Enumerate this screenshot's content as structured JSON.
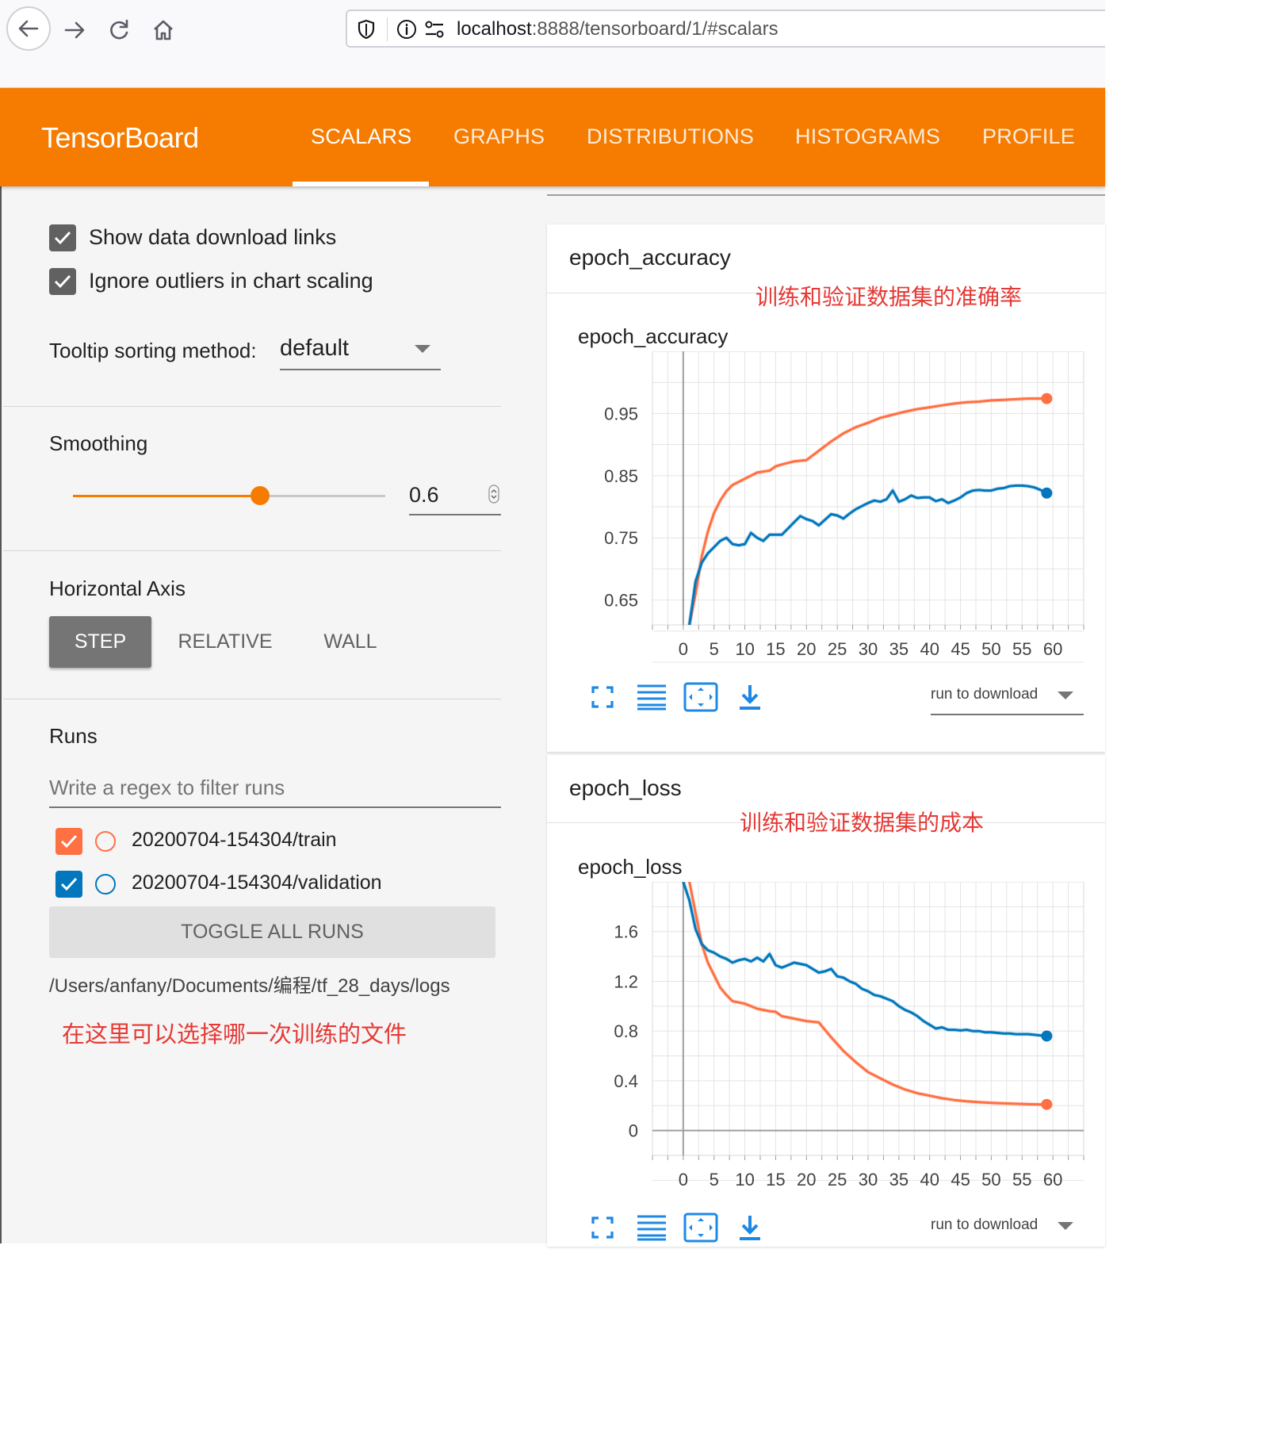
{
  "browser": {
    "url_host": "localhost",
    "url_rest": ":8888/tensorboard/1/#scalars"
  },
  "header": {
    "brand": "TensorBoard",
    "tabs": [
      "SCALARS",
      "GRAPHS",
      "DISTRIBUTIONS",
      "HISTOGRAMS",
      "PROFILE"
    ],
    "active_tab": "SCALARS",
    "color": "#f57c00"
  },
  "sidebar": {
    "options": [
      {
        "label": "Show data download links",
        "checked": true
      },
      {
        "label": "Ignore outliers in chart scaling",
        "checked": true
      }
    ],
    "tooltip_label": "Tooltip sorting method:",
    "tooltip_value": "default",
    "smoothing_title": "Smoothing",
    "smoothing_value": "0.6",
    "horizontal_axis_title": "Horizontal Axis",
    "axis_buttons": [
      "STEP",
      "RELATIVE",
      "WALL"
    ],
    "axis_selected": "STEP",
    "runs_title": "Runs",
    "filter_placeholder": "Write a regex to filter runs",
    "runs": [
      {
        "name": "20200704-154304/train",
        "checked": true,
        "color": "#ff7043"
      },
      {
        "name": "20200704-154304/validation",
        "checked": true,
        "color": "#0277bd"
      }
    ],
    "toggle_label": "TOGGLE ALL RUNS",
    "logdir": "/Users/anfany/Documents/编程/tf_28_days/logs",
    "note": "在这里可以选择哪一次训练的文件"
  },
  "cards": [
    {
      "title": "epoch_accuracy",
      "note": "训练和验证数据集的准确率",
      "chart_title": "epoch_accuracy",
      "download_label": "run to download"
    },
    {
      "title": "epoch_loss",
      "note": "训练和验证数据集的成本",
      "chart_title": "epoch_loss",
      "download_label": "run to download"
    }
  ],
  "chart_data": [
    {
      "type": "line",
      "title": "epoch_accuracy",
      "x_ticks": [
        0,
        5,
        10,
        15,
        20,
        25,
        30,
        35,
        40,
        45,
        50,
        55,
        60
      ],
      "y_ticks": [
        "0.65",
        "0.75",
        "0.85",
        "0.95"
      ],
      "xlim": [
        -5,
        65
      ],
      "ylim": [
        0.61,
        1.05
      ],
      "grid": true,
      "series": [
        {
          "name": "20200704-154304/train",
          "color": "#ff7043",
          "x": [
            1,
            2,
            3,
            4,
            5,
            6,
            7,
            8,
            10,
            12,
            14,
            15,
            16,
            18,
            20,
            22,
            24,
            26,
            28,
            30,
            32,
            34,
            36,
            38,
            40,
            42,
            44,
            46,
            48,
            50,
            52,
            54,
            56,
            58,
            59
          ],
          "y": [
            0.61,
            0.66,
            0.72,
            0.76,
            0.79,
            0.81,
            0.825,
            0.835,
            0.845,
            0.855,
            0.858,
            0.865,
            0.868,
            0.873,
            0.875,
            0.89,
            0.905,
            0.918,
            0.928,
            0.935,
            0.943,
            0.948,
            0.953,
            0.957,
            0.96,
            0.963,
            0.966,
            0.968,
            0.969,
            0.971,
            0.972,
            0.973,
            0.974,
            0.974,
            0.974
          ]
        },
        {
          "name": "20200704-154304/validation",
          "color": "#0277bd",
          "x": [
            1,
            2,
            3,
            4,
            5,
            6,
            7,
            8,
            9,
            10,
            11,
            12,
            13,
            14,
            15,
            16,
            17,
            18,
            19,
            20,
            21,
            22,
            23,
            24,
            25,
            26,
            27,
            28,
            29,
            30,
            31,
            32,
            33,
            34,
            35,
            36,
            37,
            38,
            39,
            40,
            41,
            42,
            43,
            44,
            45,
            46,
            47,
            48,
            49,
            50,
            51,
            52,
            53,
            54,
            55,
            56,
            57,
            58,
            59
          ],
          "y": [
            0.61,
            0.68,
            0.71,
            0.725,
            0.735,
            0.745,
            0.75,
            0.74,
            0.738,
            0.74,
            0.758,
            0.75,
            0.745,
            0.755,
            0.755,
            0.755,
            0.765,
            0.775,
            0.785,
            0.78,
            0.777,
            0.77,
            0.779,
            0.788,
            0.786,
            0.781,
            0.789,
            0.796,
            0.801,
            0.806,
            0.81,
            0.808,
            0.812,
            0.826,
            0.808,
            0.812,
            0.818,
            0.814,
            0.815,
            0.815,
            0.809,
            0.812,
            0.806,
            0.81,
            0.815,
            0.822,
            0.826,
            0.827,
            0.826,
            0.826,
            0.829,
            0.83,
            0.833,
            0.834,
            0.834,
            0.833,
            0.831,
            0.827,
            0.822
          ]
        }
      ]
    },
    {
      "type": "line",
      "title": "epoch_loss",
      "x_ticks": [
        0,
        5,
        10,
        15,
        20,
        25,
        30,
        35,
        40,
        45,
        50,
        55,
        60
      ],
      "y_ticks": [
        "0",
        "0.4",
        "0.8",
        "1.2",
        "1.6"
      ],
      "xlim": [
        -5,
        65
      ],
      "ylim": [
        -0.2,
        2.0
      ],
      "grid": true,
      "series": [
        {
          "name": "20200704-154304/train",
          "color": "#ff7043",
          "x": [
            1,
            2,
            3,
            4,
            5,
            6,
            7,
            8,
            10,
            12,
            14,
            15,
            16,
            18,
            20,
            22,
            24,
            26,
            28,
            30,
            32,
            34,
            36,
            38,
            40,
            42,
            44,
            46,
            48,
            50,
            52,
            54,
            56,
            58,
            59
          ],
          "y": [
            2.0,
            1.75,
            1.5,
            1.35,
            1.25,
            1.15,
            1.09,
            1.04,
            1.02,
            0.98,
            0.96,
            0.955,
            0.92,
            0.9,
            0.88,
            0.87,
            0.75,
            0.64,
            0.55,
            0.47,
            0.42,
            0.37,
            0.33,
            0.3,
            0.28,
            0.26,
            0.245,
            0.235,
            0.228,
            0.222,
            0.218,
            0.215,
            0.212,
            0.21,
            0.21
          ]
        },
        {
          "name": "20200704-154304/validation",
          "color": "#0277bd",
          "x": [
            0,
            1,
            2,
            3,
            4,
            5,
            6,
            7,
            8,
            9,
            10,
            11,
            12,
            13,
            14,
            15,
            16,
            17,
            18,
            19,
            20,
            21,
            22,
            23,
            24,
            25,
            26,
            27,
            28,
            29,
            30,
            31,
            32,
            33,
            34,
            35,
            36,
            37,
            38,
            39,
            40,
            41,
            42,
            43,
            44,
            45,
            46,
            47,
            48,
            49,
            50,
            51,
            52,
            53,
            54,
            55,
            56,
            57,
            58,
            59
          ],
          "y": [
            2.0,
            1.85,
            1.62,
            1.5,
            1.45,
            1.43,
            1.4,
            1.38,
            1.35,
            1.37,
            1.38,
            1.36,
            1.39,
            1.36,
            1.42,
            1.33,
            1.31,
            1.33,
            1.35,
            1.34,
            1.33,
            1.3,
            1.27,
            1.28,
            1.3,
            1.24,
            1.23,
            1.2,
            1.18,
            1.14,
            1.12,
            1.09,
            1.08,
            1.06,
            1.04,
            1.0,
            0.97,
            0.95,
            0.92,
            0.88,
            0.85,
            0.82,
            0.83,
            0.81,
            0.81,
            0.805,
            0.81,
            0.8,
            0.8,
            0.79,
            0.79,
            0.785,
            0.78,
            0.78,
            0.775,
            0.775,
            0.775,
            0.77,
            0.765,
            0.76
          ]
        }
      ]
    }
  ]
}
